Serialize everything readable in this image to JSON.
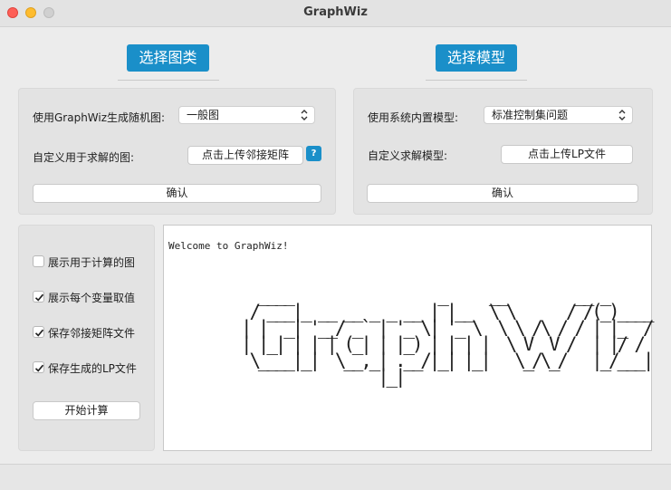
{
  "window": {
    "title": "GraphWiz"
  },
  "sections": {
    "graph_tab": "选择图类",
    "model_tab": "选择模型"
  },
  "graph_panel": {
    "random_label": "使用GraphWiz生成随机图:",
    "random_select": "一般图",
    "custom_label": "自定义用于求解的图:",
    "upload_button": "点击上传邻接矩阵",
    "help_button": "?",
    "confirm_button": "确认"
  },
  "model_panel": {
    "builtin_label": "使用系统内置模型:",
    "builtin_select": "标准控制集问题",
    "custom_label": "自定义求解模型:",
    "upload_button": "点击上传LP文件",
    "confirm_button": "确认"
  },
  "options": [
    {
      "label": "展示用于计算的图",
      "checked": false
    },
    {
      "label": "展示每个变量取值",
      "checked": true
    },
    {
      "label": "保存邻接矩阵文件",
      "checked": true
    },
    {
      "label": "保存生成的LP文件",
      "checked": true
    }
  ],
  "start_button": "开始计算",
  "console": {
    "welcome": "Welcome to GraphWiz!",
    "ascii_art": "  ____                 _     __        __ _     \n / ___|_ __ __ _ _ __ | |__  \\ \\      / /(_)____\n| |  _| '__/ _` | '_ \\| '_ \\  \\ \\ /\\ / / | |_  /\n| |_| | | | (_| | |_) | | | |  \\ V  V /  | |/ / \n \\____|_|  \\__,_| .__/|_| |_|   \\_/\\_/   |_/___|\n                |_|                             "
  }
}
